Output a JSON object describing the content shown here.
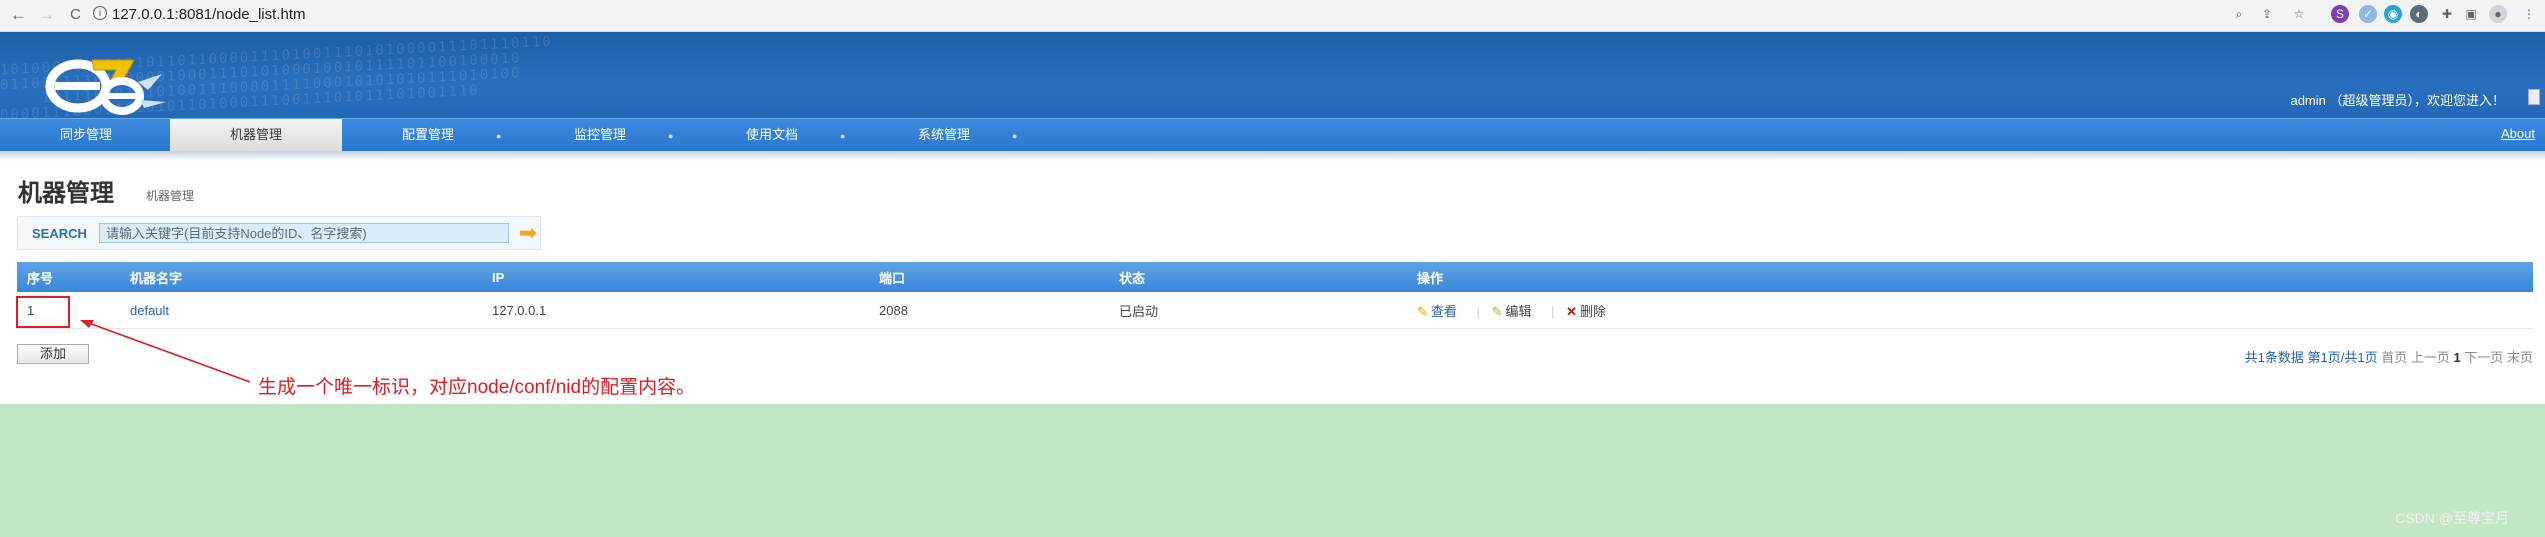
{
  "browser": {
    "url": "127.0.0.1:8081/node_list.htm",
    "back": "←",
    "forward": "→",
    "reload": "C"
  },
  "header": {
    "welcome": "admin （超级管理员），欢迎您进入！"
  },
  "menu": {
    "items": [
      {
        "label": "同步管理",
        "active": false
      },
      {
        "label": "机器管理",
        "active": true
      },
      {
        "label": "配置管理",
        "active": false
      },
      {
        "label": "监控管理",
        "active": false
      },
      {
        "label": "使用文档",
        "active": false
      },
      {
        "label": "系统管理",
        "active": false
      }
    ],
    "about": "About"
  },
  "page": {
    "title": "机器管理",
    "subtitle": "机器管理"
  },
  "search": {
    "label": "SEARCH",
    "placeholder": "请输入关键字(目前支持Node的ID、名字搜索)"
  },
  "table": {
    "columns": [
      "序号",
      "机器名字",
      "IP",
      "端口",
      "状态",
      "操作"
    ],
    "rows": [
      {
        "id": "1",
        "name": "default",
        "ip": "127.0.0.1",
        "port": "2088",
        "status": "已启动"
      }
    ],
    "actions": {
      "view": "查看",
      "edit": "编辑",
      "delete": "删除"
    }
  },
  "add_button": "添加",
  "pager": {
    "total": "共1条数据",
    "page": "第1页/共1页",
    "first": "首页",
    "prev": "上一页",
    "current": "1",
    "next": "下一页",
    "last": "末页"
  },
  "annotation": "生成一个唯一标识，对应node/conf/nid的配置内容。",
  "watermark": "CSDN @至尊宝月",
  "colors": {
    "banner": "#1c5ea8",
    "menu": "#2a76cf",
    "annotation": "#e01c24",
    "background": "#c3e6c6"
  }
}
